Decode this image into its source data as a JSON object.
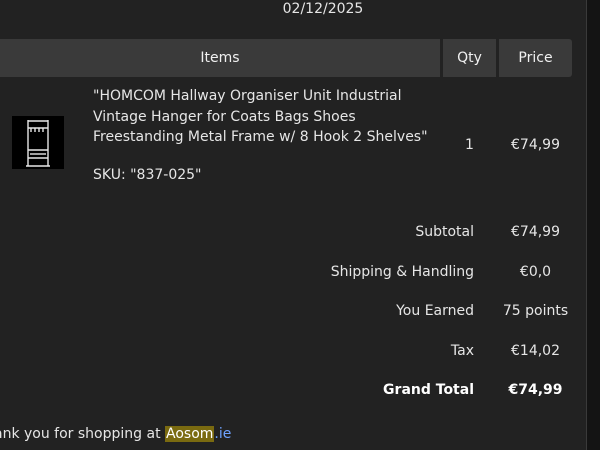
{
  "order": {
    "date": "02/12/2025"
  },
  "table": {
    "headers": {
      "items": "Items",
      "qty": "Qty",
      "price": "Price"
    },
    "rows": [
      {
        "name": "\"HOMCOM Hallway Organiser Unit Industrial Vintage Hanger for Coats Bags Shoes Freestanding Metal Frame w/ 8 Hook 2 Shelves\"",
        "sku": "SKU: \"837-025\"",
        "qty": "1",
        "price": "€74,99",
        "thumbnail_icon": "coat-rack-icon"
      }
    ]
  },
  "summary": {
    "subtotal": {
      "label": "Subtotal",
      "value": "€74,99"
    },
    "shipping": {
      "label": "Shipping & Handling",
      "value": "€0,0"
    },
    "earned": {
      "label": "You Earned",
      "value": "75 points"
    },
    "tax": {
      "label": "Tax",
      "value": "€14,02"
    },
    "grand_total": {
      "label": "Grand Total",
      "value": "€74,99"
    }
  },
  "footer": {
    "thanks_text": "ank you for shopping at ",
    "brand": "Aosom",
    "domain": ".ie",
    "brand_highlight_color": "#7a6a10",
    "link_color": "#6fa3ff"
  }
}
